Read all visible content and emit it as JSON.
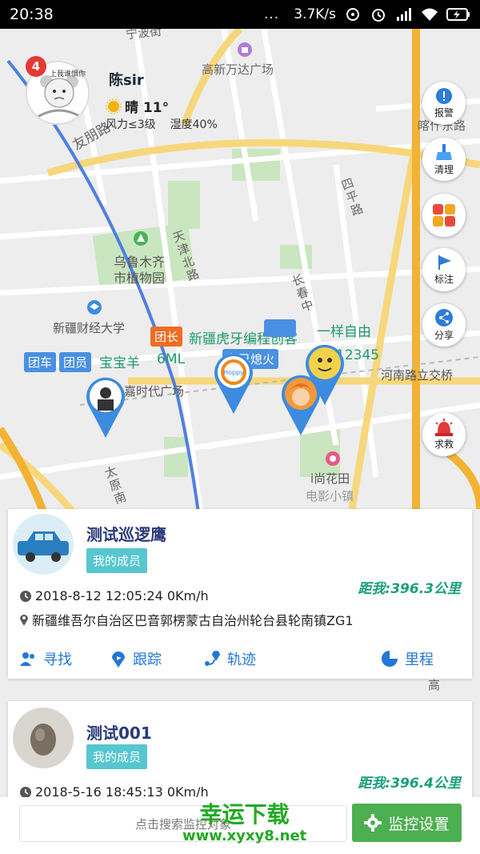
{
  "status_bar": {
    "time": "20:38",
    "dots": "...",
    "speed": "3.7K/s"
  },
  "map": {
    "labels": {
      "ningbo": "宁波街",
      "wanda": "高新万达广场",
      "youhao": "友朋路",
      "kashi": "喀什东路",
      "siping": "四平路",
      "tianjin": "天津北路",
      "botanical_1": "乌鲁木齐",
      "botanical_2": "市植物园",
      "changchun": "长春中",
      "finance": "新疆财经大学",
      "times": "嘉时代广场",
      "henan": "河南路立交桥",
      "taiyuan": "太原南",
      "huatian_1": "i尚花田",
      "huatian_2": "电影小镇",
      "gaoxin": "高"
    },
    "tags": {
      "team_car": "团车",
      "member": "团员",
      "baobao": "宝宝羊",
      "ml": "6ML",
      "leader": "团长",
      "huya": "新疆虎牙编程创客",
      "free": "一样自由",
      "rest": "车已熄火",
      "num": "12345"
    }
  },
  "profile": {
    "badge": "4",
    "name": "陈sir",
    "weather": "晴 11°",
    "wind": "风力≤3级",
    "humidity": "湿度40%",
    "avatar_caption": "上我谁惧你"
  },
  "side_buttons": [
    {
      "label": "报警",
      "icon": "alarm-bell-icon"
    },
    {
      "label": "清理",
      "icon": "broom-icon"
    },
    {
      "label": "",
      "icon": "apps-grid-icon"
    },
    {
      "label": "标注",
      "icon": "flag-icon"
    },
    {
      "label": "分享",
      "icon": "share-icon"
    },
    {
      "label": "求救",
      "icon": "siren-icon"
    }
  ],
  "cards": [
    {
      "name": "测试巡逻鹰",
      "member": "我的成员",
      "distance": "距我:396.3公里",
      "time": "2018-8-12 12:05:24   0Km/h",
      "address": "新疆维吾尔自治区巴音郭楞蒙古自治州轮台县轮南镇ZG1",
      "actions": [
        "寻找",
        "跟踪",
        "轨迹",
        "里程"
      ]
    },
    {
      "name": "测试001",
      "member": "我的成员",
      "distance": "距我:396.4公里",
      "time": "2018-5-16 18:45:13   0Km/h"
    }
  ],
  "bottom": {
    "search_placeholder": "点击搜索监控对象",
    "monitor_label": "监控设置"
  },
  "watermark": {
    "line1": "幸运下载",
    "line2": "www.xyxy8.net"
  }
}
